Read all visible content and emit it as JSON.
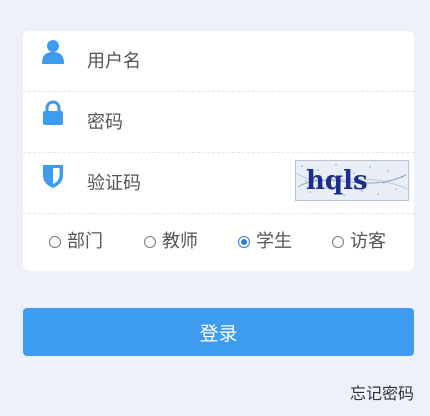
{
  "form": {
    "username_placeholder": "用户名",
    "password_placeholder": "密码",
    "captcha_placeholder": "验证码",
    "captcha_text": "hqls"
  },
  "roles": {
    "options": [
      "部门",
      "教师",
      "学生",
      "访客"
    ],
    "selected": "学生"
  },
  "actions": {
    "login_label": "登录",
    "forgot_label": "忘记密码"
  },
  "colors": {
    "background": "#eef0fb",
    "card": "#ffffff",
    "accent": "#3d9cf0",
    "radio_selected": "#2f7be6"
  },
  "icons": {
    "username": "user-icon",
    "password": "lock-icon",
    "captcha": "shield-icon"
  }
}
